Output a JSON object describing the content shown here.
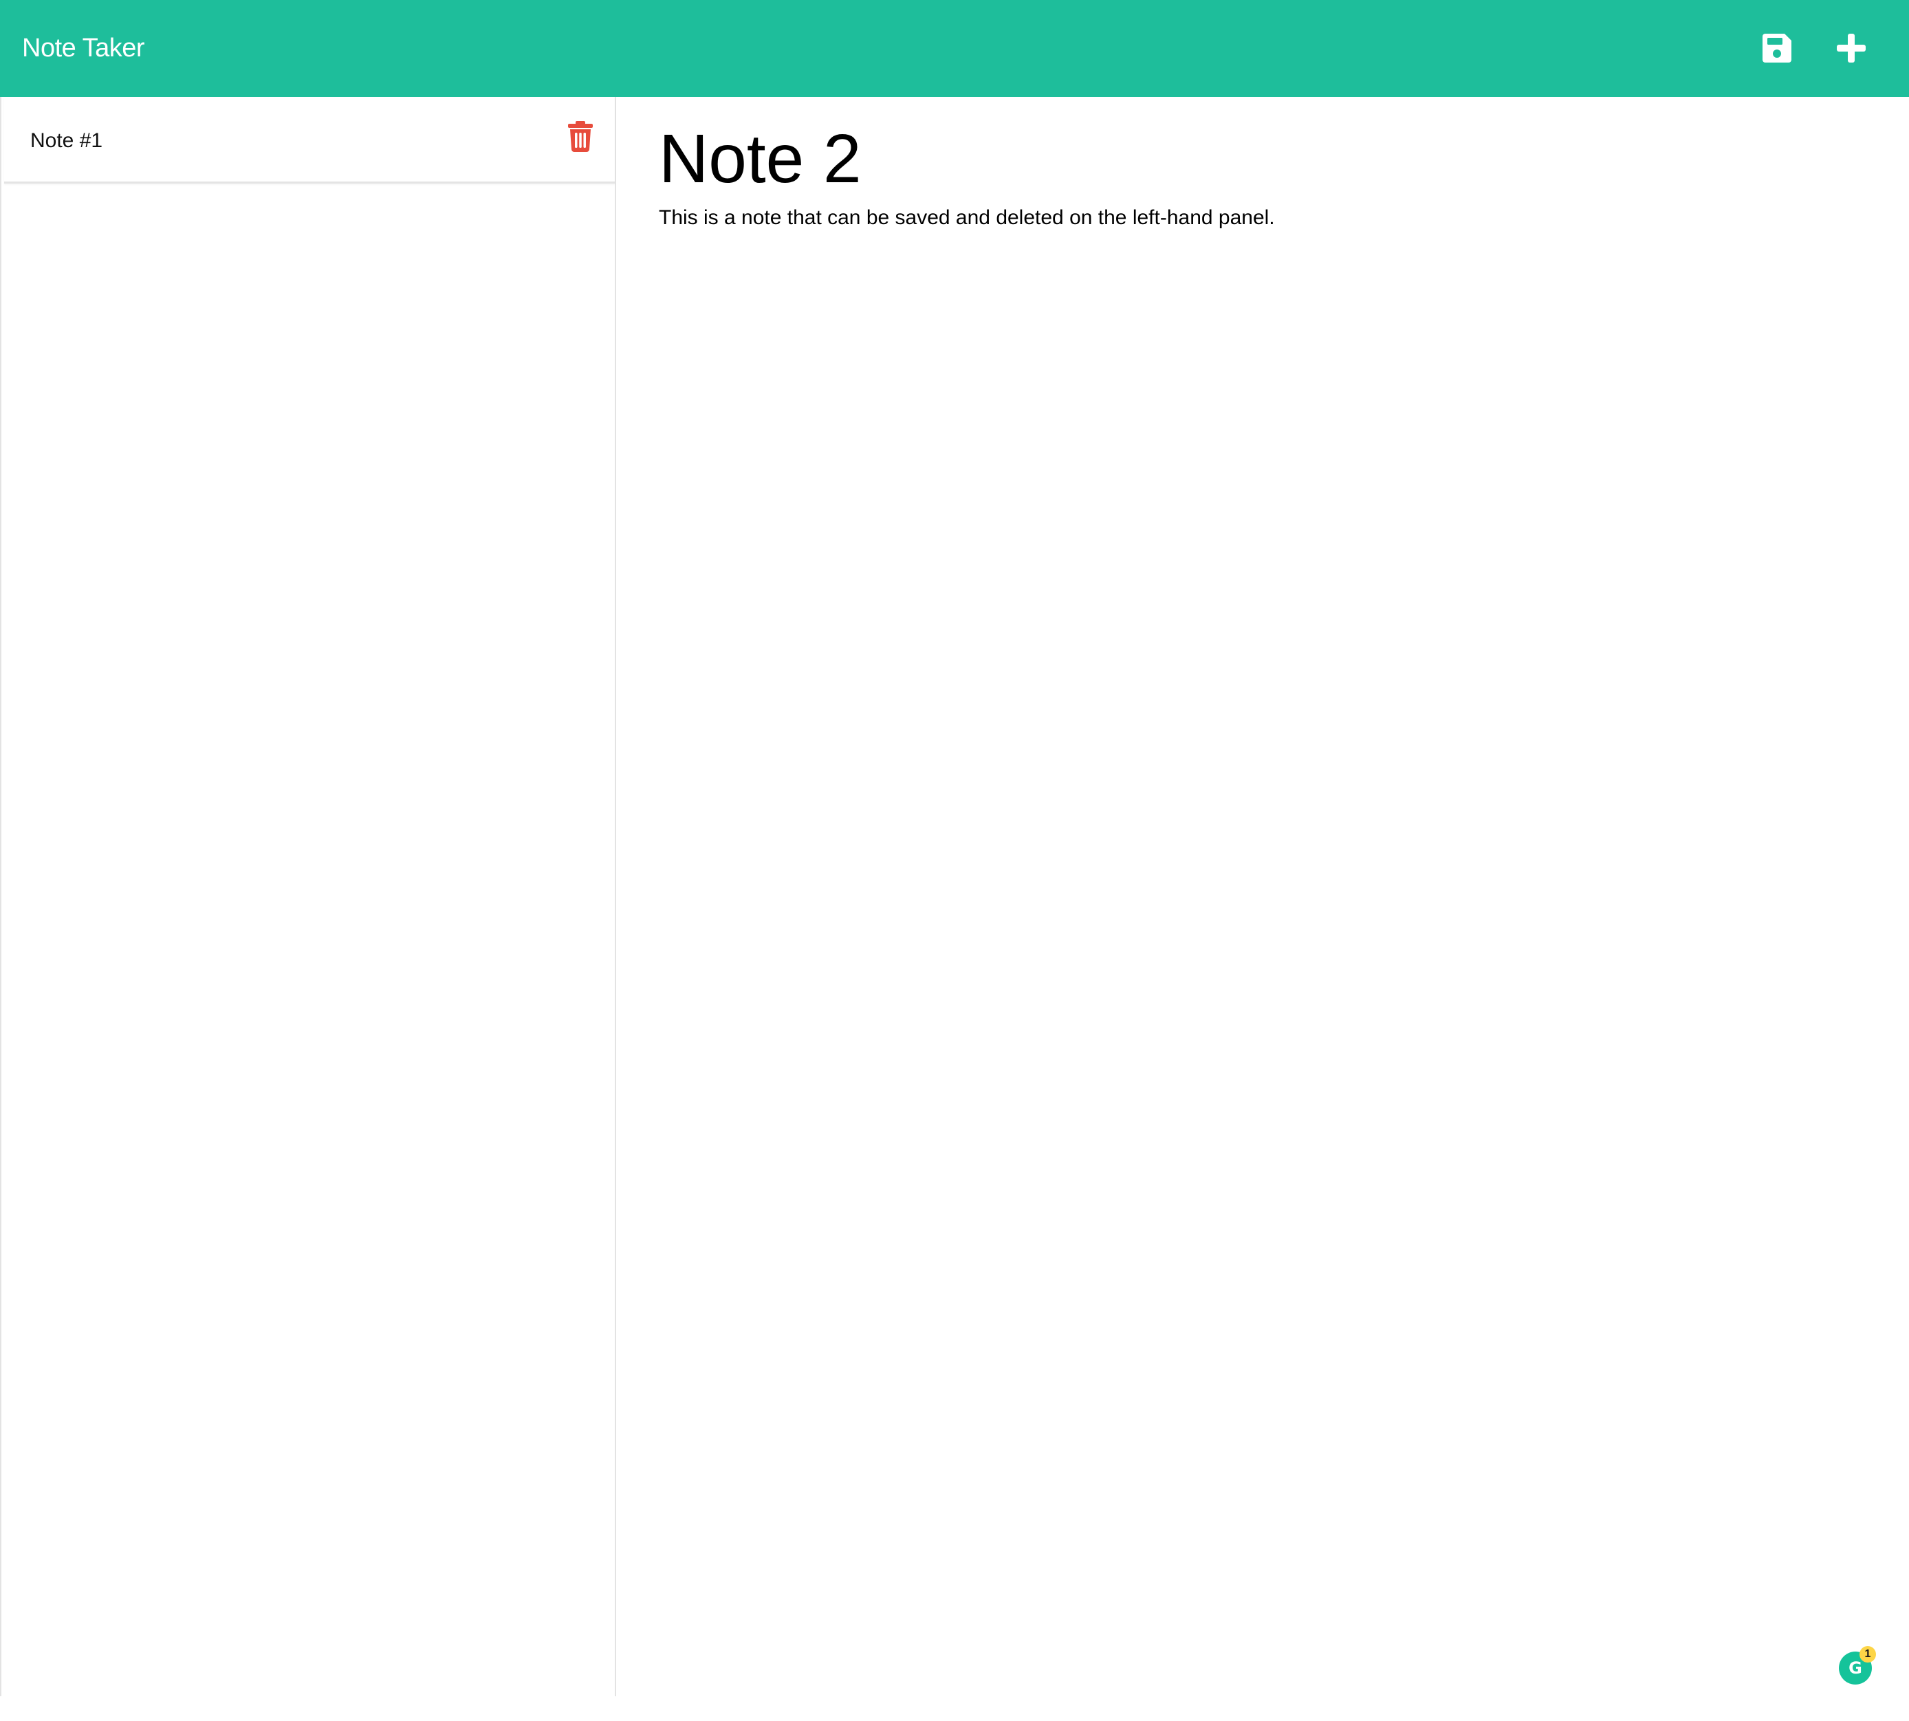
{
  "navbar": {
    "brand": "Note Taker",
    "save_icon": "floppy-disk-icon",
    "add_icon": "plus-icon",
    "background_color": "#1ebe9b"
  },
  "sidebar": {
    "notes": [
      {
        "title": "Note #1",
        "delete_icon": "trash-icon",
        "delete_color": "#e74c3c"
      }
    ]
  },
  "editor": {
    "title_value": "Note 2",
    "text_value": "This is a note that can be saved and deleted on the left-hand panel."
  },
  "grammarly": {
    "icon": "grammarly-icon",
    "letter": "G",
    "badge_count": "1"
  }
}
